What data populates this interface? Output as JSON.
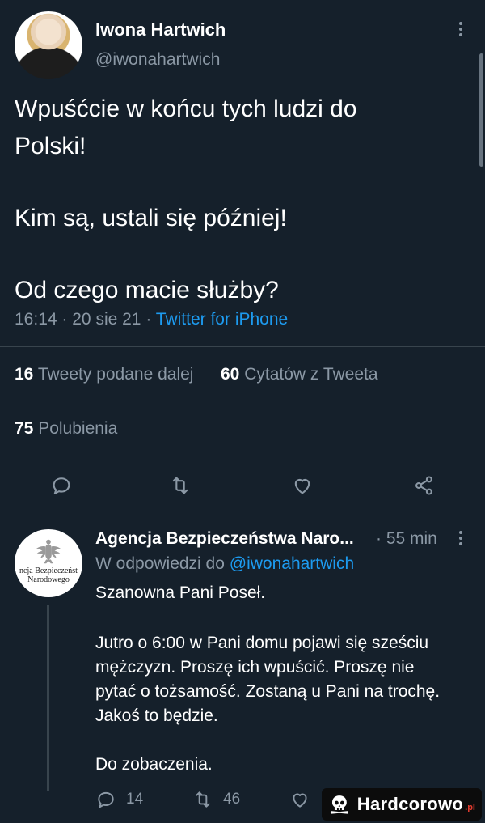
{
  "tweet": {
    "author_name": "Iwona Hartwich",
    "author_handle": "@iwonahartwich",
    "text_lines": [
      "Wpuśćcie w końcu tych ludzi do",
      "Polski!",
      "Kim są, ustali się później!",
      "Od czego macie służby?"
    ],
    "time": "16:14",
    "date": "20 sie 21",
    "source": "Twitter for iPhone",
    "separator": "·",
    "stats": {
      "retweets_count": "16",
      "retweets_label": "Tweety podane dalej",
      "quotes_count": "60",
      "quotes_label": "Cytatów z Tweeta",
      "likes_count": "75",
      "likes_label": "Polubienia"
    },
    "actions": [
      "reply-icon",
      "retweet-icon",
      "like-icon",
      "share-icon"
    ]
  },
  "reply": {
    "author_name": "Agencja Bezpieczeństwa Naro...",
    "time": "· 55 min",
    "reply_to_prefix": "W odpowiedzi do",
    "reply_to_handle": "@iwonahartwich",
    "avatar_text_line1": "ncja Bezpieczeńst",
    "avatar_text_line2": "Narodowego",
    "text_lines": [
      "Szanowna Pani Poseł.",
      "Jutro o 6:00 w Pani domu pojawi się sześciu",
      "mężczyzn. Proszę ich wpuścić. Proszę nie",
      "pytać o tożsamość. Zostaną u Pani na trochę.",
      "Jakoś to będzie.",
      "Do zobaczenia."
    ],
    "reply_count": "14",
    "retweet_count": "46"
  },
  "watermark": {
    "brand": "Hardcorowo",
    "tld": ".pl",
    "tld_color": "#e23b2e"
  },
  "colors": {
    "background": "#15202b",
    "text": "#ffffff",
    "secondary": "#8b98a5",
    "link": "#1d9bf0",
    "divider": "#38444d"
  }
}
